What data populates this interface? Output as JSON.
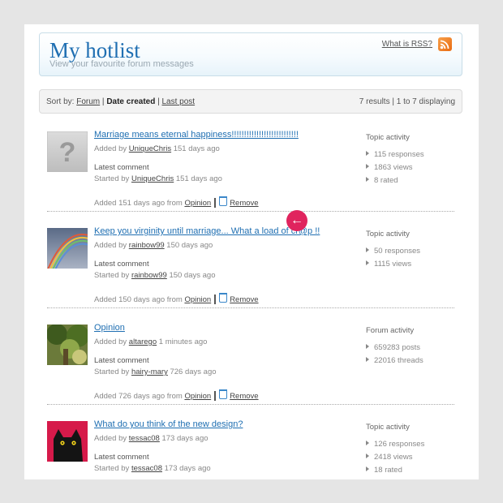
{
  "header": {
    "title": "My hotlist",
    "subtitle": "View your favourite forum messages",
    "rss_link": "What is RSS?"
  },
  "sort": {
    "label": "Sort by:",
    "option_forum": "Forum",
    "option_date": "Date created",
    "option_last_post": "Last post",
    "results": "7 results | 1 to 7 displaying"
  },
  "entries": [
    {
      "title": "Marriage means eternal happiness!!!!!!!!!!!!!!!!!!!!!!!!!!!",
      "added_prefix": "Added by",
      "added_user": "UniqueChris",
      "added_time": "151 days ago",
      "latest": "Latest comment",
      "started_prefix": "Started by",
      "started_user": "UniqueChris",
      "started_time": "151 days ago",
      "footer_prefix": "Added 151 days ago from",
      "forum": "Opinion",
      "remove": "Remove",
      "stats_heading": "Topic activity",
      "stats": [
        "115 responses",
        "1863 views",
        "8 rated"
      ],
      "thumb": "question-mark-icon"
    },
    {
      "title": "Keep you virginity until marriage... What a load of cr@p !!",
      "added_prefix": "Added by",
      "added_user": "rainbow99",
      "added_time": "150 days ago",
      "latest": "Latest comment",
      "started_prefix": "Started by",
      "started_user": "rainbow99",
      "started_time": "150 days ago",
      "footer_prefix": "Added 150 days ago from",
      "forum": "Opinion",
      "remove": "Remove",
      "stats_heading": "Topic activity",
      "stats": [
        "50 responses",
        "1115 views"
      ],
      "thumb": "rainbow-photo"
    },
    {
      "title": "Opinion",
      "added_prefix": "Added by",
      "added_user": "altarego",
      "added_time": "1 minutes ago",
      "latest": "Latest comment",
      "started_prefix": "Started by",
      "started_user": "hairy-mary",
      "started_time": "726 days ago",
      "footer_prefix": "Added 726 days ago from",
      "forum": "Opinion",
      "remove": "Remove",
      "stats_heading": "Forum activity",
      "stats": [
        "659283 posts",
        "22016 threads"
      ],
      "thumb": "tree-photo"
    },
    {
      "title": "What do you think of the new design?",
      "added_prefix": "Added by",
      "added_user": "tessac08",
      "added_time": "173 days ago",
      "latest": "Latest comment",
      "started_prefix": "Started by",
      "started_user": "tessac08",
      "started_time": "173 days ago",
      "stats_heading": "Topic activity",
      "stats": [
        "126 responses",
        "2418 views",
        "18 rated"
      ],
      "thumb": "cat-photo"
    }
  ],
  "icons": {
    "rss": "rss-icon",
    "arrow": "arrow-left-icon",
    "trash": "trash-icon"
  },
  "colors": {
    "accent": "#1f6fb2",
    "marker": "#e0245e",
    "rss": "#e96b12"
  }
}
